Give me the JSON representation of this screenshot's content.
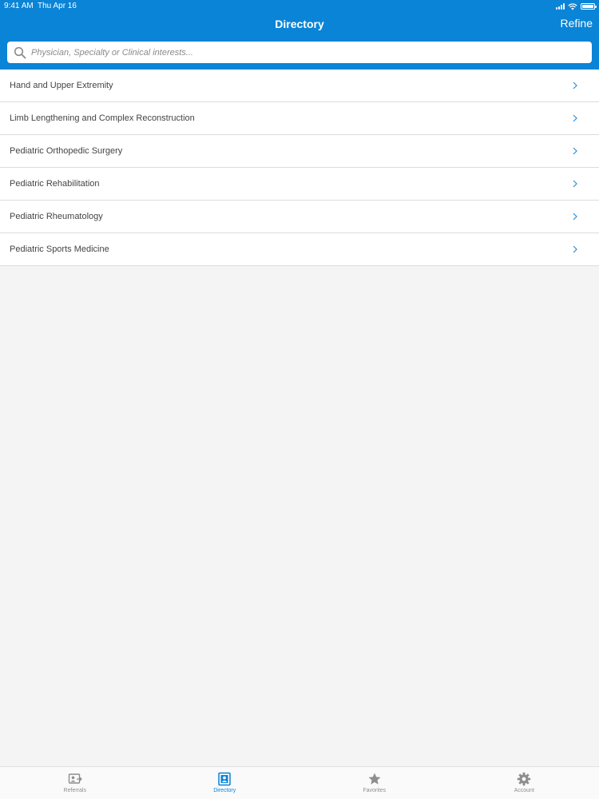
{
  "status_bar": {
    "time": "9:41 AM",
    "date": "Thu Apr 16",
    "icons": [
      "signal-icon",
      "wifi-icon",
      "battery-icon"
    ]
  },
  "nav": {
    "title": "Directory",
    "refine_label": "Refine"
  },
  "search": {
    "placeholder": "Physician, Specialty or Clinical interests...",
    "value": "",
    "icon": "search-icon"
  },
  "list": {
    "items": [
      {
        "label": "Hand and Upper Extremity"
      },
      {
        "label": "Limb Lengthening and Complex Reconstruction"
      },
      {
        "label": "Pediatric Orthopedic Surgery"
      },
      {
        "label": "Pediatric Rehabilitation"
      },
      {
        "label": "Pediatric Rheumatology"
      },
      {
        "label": "Pediatric Sports Medicine"
      }
    ]
  },
  "tabbar": {
    "tabs": [
      {
        "label": "Referrals",
        "icon": "referrals-icon",
        "active": false
      },
      {
        "label": "Directory",
        "icon": "directory-icon",
        "active": true
      },
      {
        "label": "Favorites",
        "icon": "star-icon",
        "active": false
      },
      {
        "label": "Account",
        "icon": "gear-icon",
        "active": false
      }
    ]
  },
  "colors": {
    "header_bg": "#0a84d6",
    "accent": "#0a84d6",
    "page_bg": "#f4f4f4",
    "tab_inactive": "#8e8e8e"
  }
}
